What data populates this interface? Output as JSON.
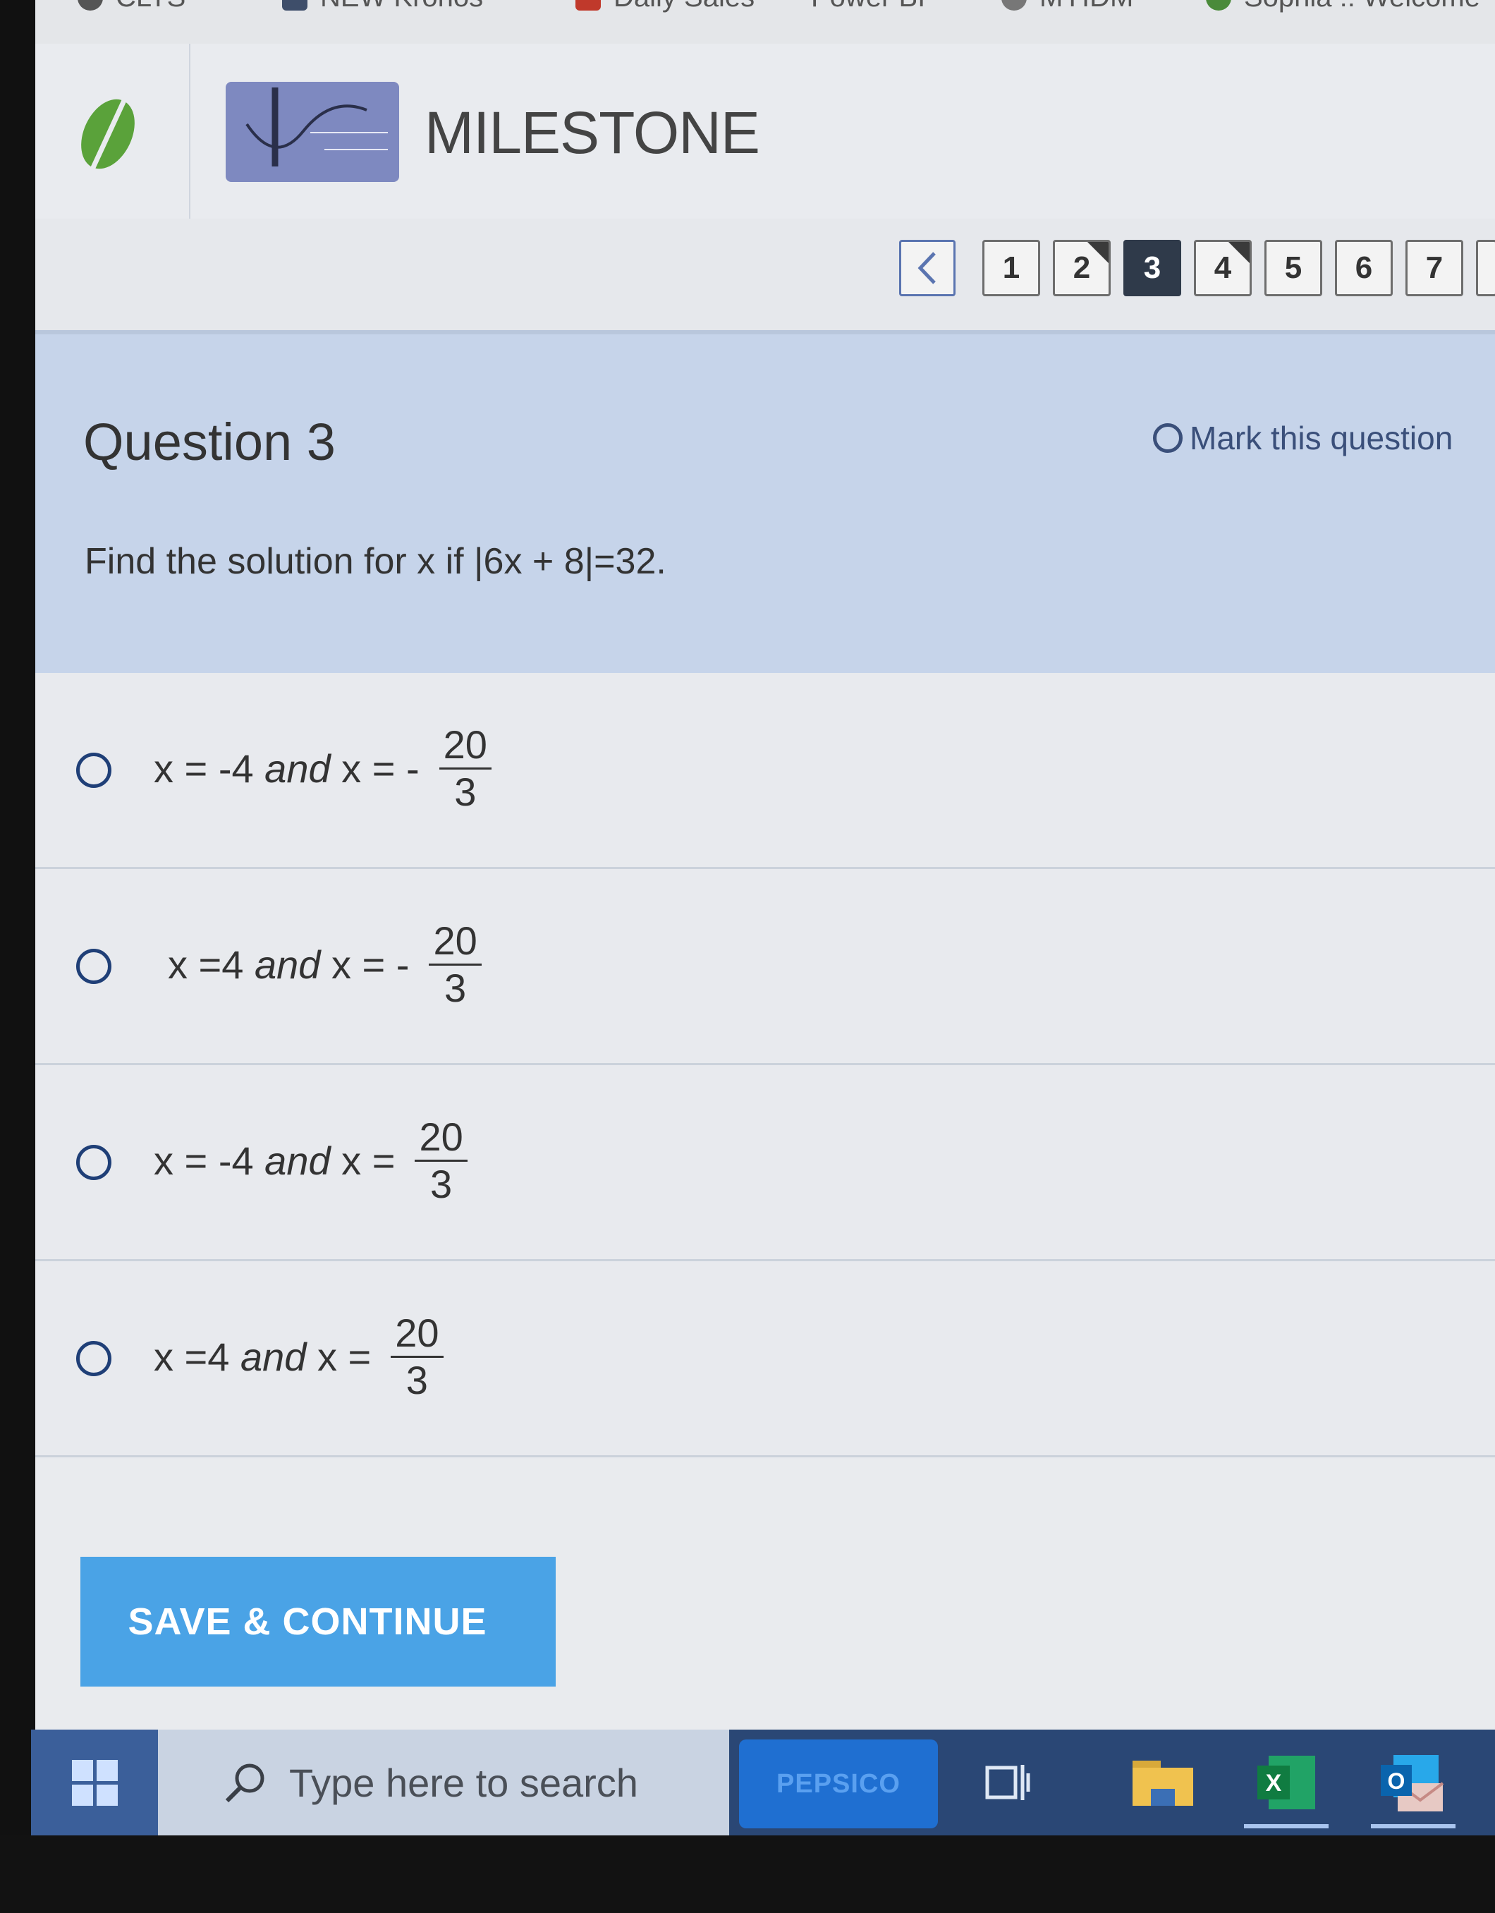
{
  "browser": {
    "bookmarks": [
      "CLTS",
      "NEW Kronos",
      "Daily Sales",
      "Power BI",
      "MYIDM",
      "Sophia :: Welcome"
    ]
  },
  "app": {
    "title": "MILESTONE",
    "accent_color": "#4aa3e6"
  },
  "navigation": {
    "prev_icon": "chevron-left-icon",
    "questions": [
      {
        "label": "1",
        "state": "default"
      },
      {
        "label": "2",
        "state": "marked"
      },
      {
        "label": "3",
        "state": "current"
      },
      {
        "label": "4",
        "state": "marked"
      },
      {
        "label": "5",
        "state": "default"
      },
      {
        "label": "6",
        "state": "default"
      },
      {
        "label": "7",
        "state": "default"
      }
    ]
  },
  "question": {
    "title": "Question 3",
    "mark_label": "Mark this question",
    "text": "Find the solution for x if |6x + 8|=32."
  },
  "answers": [
    {
      "lhs_a": "x = -4 ",
      "and": "and",
      "lhs_b": " x = -",
      "num": "20",
      "den": "3",
      "selected": false
    },
    {
      "lhs_a": "x =4 ",
      "and": "and",
      "lhs_b": " x = -",
      "num": "20",
      "den": "3",
      "selected": false
    },
    {
      "lhs_a": "x = -4 ",
      "and": "and",
      "lhs_b": " x =",
      "num": "20",
      "den": "3",
      "selected": false
    },
    {
      "lhs_a": "x =4 ",
      "and": "and",
      "lhs_b": " x =",
      "num": "20",
      "den": "3",
      "selected": false
    }
  ],
  "actions": {
    "save_label": "SAVE & CONTINUE"
  },
  "taskbar": {
    "search_placeholder": "Type here to search",
    "pinned_badge": "PEPSICO",
    "icons": [
      "windows-start-icon",
      "search-icon",
      "task-view-icon",
      "file-explorer-icon",
      "excel-icon",
      "outlook-icon"
    ]
  }
}
